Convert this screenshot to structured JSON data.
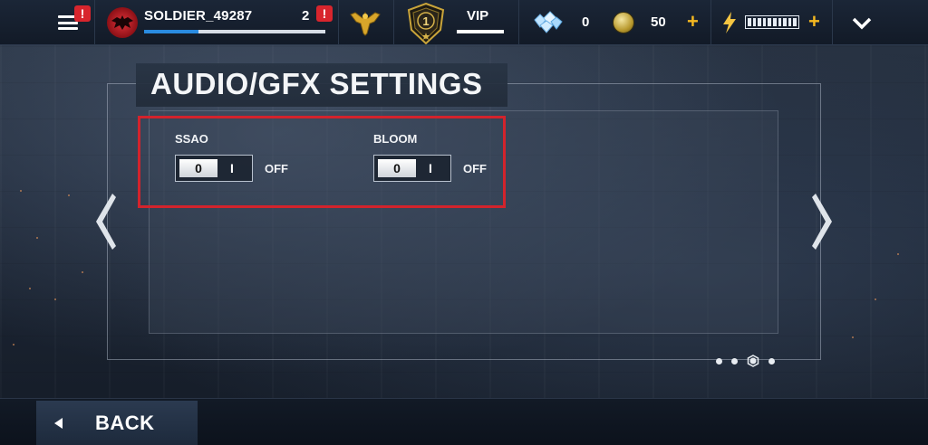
{
  "topbar": {
    "player_name": "SOLDIER_49287",
    "player_level": "2",
    "menu_alert": "!",
    "level_alert": "!",
    "xp_fraction": 0.3,
    "rank_number": "1",
    "vip_label": "VIP",
    "gems": "0",
    "coins": "50",
    "plus": "+",
    "energy_segments": 10
  },
  "panel": {
    "title": "AUDIO/GFX SETTINGS",
    "settings": [
      {
        "label": "SSAO",
        "knob": "0",
        "on_mark": "I",
        "state": "OFF"
      },
      {
        "label": "BLOOM",
        "knob": "0",
        "on_mark": "I",
        "state": "OFF"
      }
    ],
    "highlight_color": "#d3232c"
  },
  "pager": {
    "pages": 4,
    "active_page": 3
  },
  "footer": {
    "back_label": "BACK"
  },
  "colors": {
    "accent_plus": "#f5b820",
    "alert": "#d8252d",
    "xp": "#2a8be0"
  }
}
